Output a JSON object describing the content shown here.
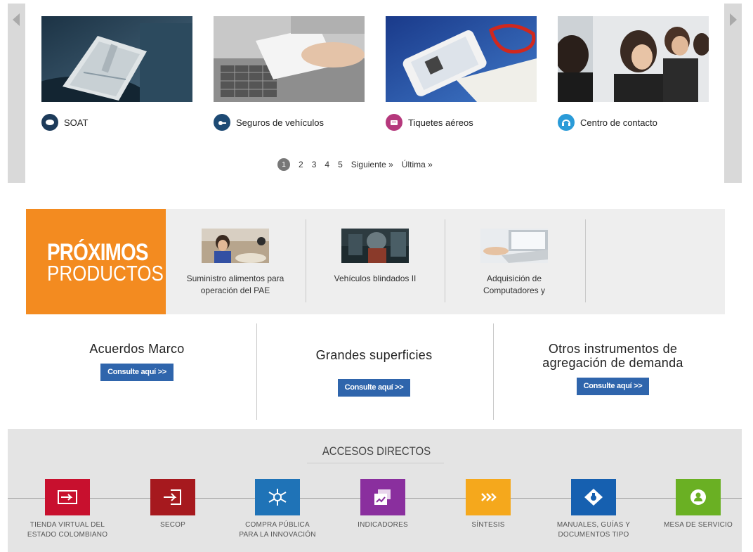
{
  "carousel": {
    "cards": [
      {
        "label": "SOAT",
        "icon": "document-icon",
        "color": "#1d3b5a"
      },
      {
        "label": "Seguros de vehículos",
        "icon": "car-key-icon",
        "color": "#1d4a74"
      },
      {
        "label": "Tiquetes aéreos",
        "icon": "ticket-icon",
        "color": "#b5387c"
      },
      {
        "label": "Centro de contacto",
        "icon": "headset-icon",
        "color": "#2a9bd8"
      }
    ],
    "pager": {
      "current": "1",
      "pages": [
        "2",
        "3",
        "4",
        "5"
      ],
      "next": "Siguiente »",
      "last": "Última »"
    }
  },
  "proximos": {
    "title_line1": "PRÓXIMOS",
    "title_line2": "PRODUCTOS",
    "accent": "#f38b20",
    "items": [
      {
        "line1": "Suministro alimentos para",
        "line2": "operación del PAE"
      },
      {
        "line1": "Vehículos blindados II",
        "line2": ""
      },
      {
        "line1": "Adquisición de",
        "line2": "Computadores y"
      }
    ]
  },
  "acuerdos": [
    {
      "title": "Acuerdos Marco",
      "title2": "",
      "button": "Consulte aquí >>"
    },
    {
      "title": "Grandes superficies",
      "title2": "",
      "button": "Consulte aquí >>"
    },
    {
      "title": "Otros instrumentos de",
      "title2": "agregación de demanda",
      "button": "Consulte aquí >>"
    }
  ],
  "accesos": {
    "title": "ACCESOS DIRECTOS",
    "items": [
      {
        "l1": "TIENDA VIRTUAL DEL",
        "l2": "ESTADO COLOMBIANO",
        "color": "#c8102e",
        "icon": "cart-icon"
      },
      {
        "l1": "SECOP",
        "l2": "",
        "color": "#a6191e",
        "icon": "login-icon"
      },
      {
        "l1": "COMPRA PÚBLICA",
        "l2": "PARA LA INNOVACIÓN",
        "color": "#1f73b7",
        "icon": "snowflake-icon"
      },
      {
        "l1": "INDICADORES",
        "l2": "",
        "color": "#8a2f9e",
        "icon": "chart-window-icon"
      },
      {
        "l1": "SÍNTESIS",
        "l2": "",
        "color": "#f5a81c",
        "icon": "chevrons-icon"
      },
      {
        "l1": "MANUALES, GUÍAS Y",
        "l2": "DOCUMENTOS TIPO",
        "color": "#1660b0",
        "icon": "book-icon"
      },
      {
        "l1": "MESA DE SERVICIO",
        "l2": "",
        "color": "#6ab023",
        "icon": "person-icon"
      }
    ]
  }
}
